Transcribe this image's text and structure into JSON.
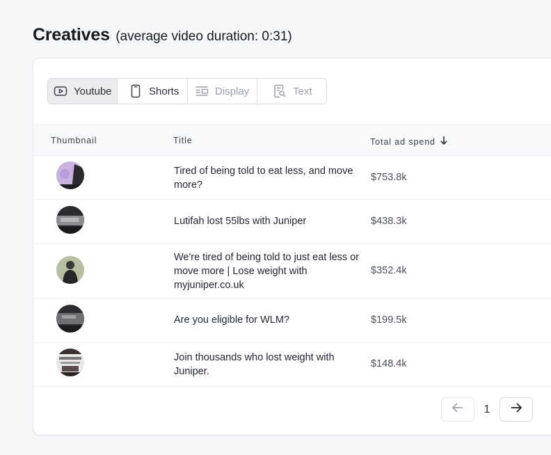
{
  "header": {
    "title": "Creatives",
    "subtitle": "(average video duration: 0:31)"
  },
  "tabs": [
    {
      "label": "Youtube",
      "icon": "youtube-video-icon",
      "state": "active"
    },
    {
      "label": "Shorts",
      "icon": "phone-icon",
      "state": "enabled"
    },
    {
      "label": "Display",
      "icon": "display-layout-icon",
      "state": "disabled"
    },
    {
      "label": "Text",
      "icon": "text-search-icon",
      "state": "disabled"
    }
  ],
  "table": {
    "columns": [
      "Thumbnail",
      "Title",
      "Total ad spend"
    ],
    "sort": {
      "column": "Total ad spend",
      "direction": "descending",
      "icon": "arrow-down-icon"
    },
    "rows": [
      {
        "title": "Tired of being told to eat less, and move more?",
        "spend": "$753.8k",
        "thumb_colors": [
          "#c9b2e0",
          "#2a2a2e"
        ]
      },
      {
        "title": "Lutifah lost 55lbs with Juniper",
        "spend": "$438.3k",
        "thumb_colors": [
          "#3a3a3f",
          "#9a9aa0"
        ]
      },
      {
        "title": "We're tired of being told to just eat less or move more | Lose weight with myjuniper.co.uk",
        "spend": "$352.4k",
        "thumb_colors": [
          "#b7c0a3",
          "#2b2b2b"
        ]
      },
      {
        "title": "Are you eligible for WLM?",
        "spend": "$199.5k",
        "thumb_colors": [
          "#2d2d31",
          "#7b7b80"
        ]
      },
      {
        "title": "Join thousands who lost weight with Juniper.",
        "spend": "$148.4k",
        "thumb_colors": [
          "#e8e8e8",
          "#3a3030"
        ]
      }
    ]
  },
  "pagination": {
    "current_page": "1",
    "prev_icon": "arrow-left-icon",
    "next_icon": "arrow-right-icon"
  },
  "colors": {
    "background": "#f6f7f9",
    "card": "#ffffff",
    "active_tab": "#ececee",
    "border": "#d9dce2"
  }
}
